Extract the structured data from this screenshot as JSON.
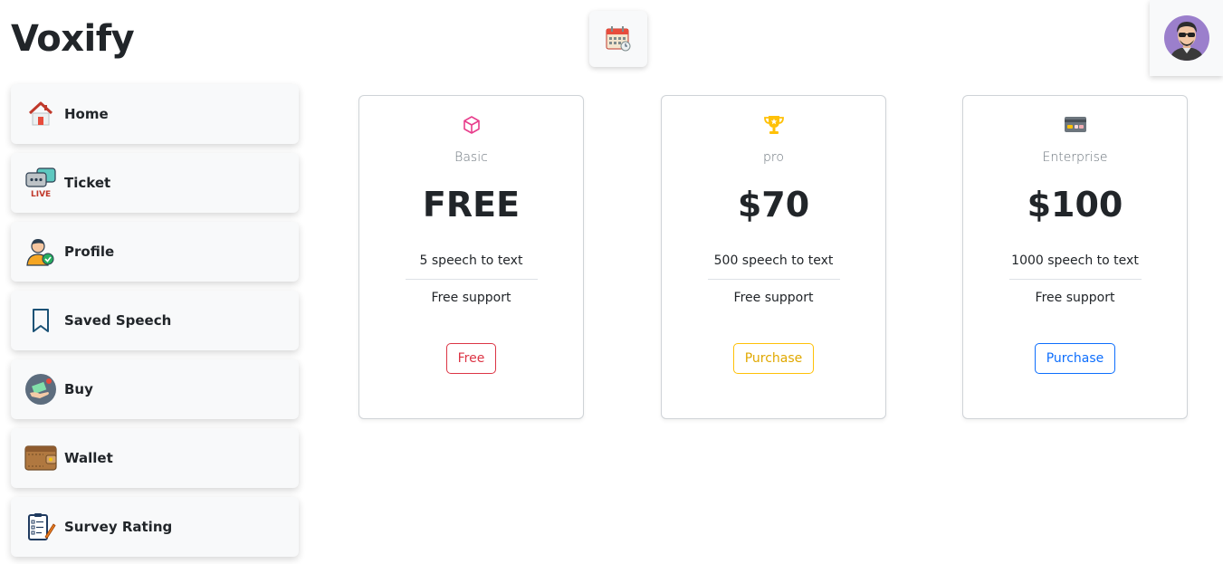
{
  "app": {
    "title": "Voxify"
  },
  "header": {
    "calendar_icon": "calendar-icon",
    "avatar_icon": "avatar-icon"
  },
  "sidebar": {
    "items": [
      {
        "label": "Home",
        "icon": "home-icon"
      },
      {
        "label": "Ticket",
        "icon": "live-chat-icon"
      },
      {
        "label": "Profile",
        "icon": "profile-icon"
      },
      {
        "label": "Saved Speech",
        "icon": "bookmark-icon"
      },
      {
        "label": "Buy",
        "icon": "buy-icon"
      },
      {
        "label": "Wallet",
        "icon": "wallet-icon"
      },
      {
        "label": "Survey Rating",
        "icon": "survey-icon"
      }
    ]
  },
  "plans": [
    {
      "name": "Basic",
      "price": "FREE",
      "feature1": "5 speech to text",
      "feature2": "Free support",
      "button": "Free",
      "icon": "box-icon",
      "accent": "#e83e8c",
      "button_color": "#dc3545"
    },
    {
      "name": "pro",
      "price": "$70",
      "feature1": "500 speech to text",
      "feature2": "Free support",
      "button": "Purchase",
      "icon": "trophy-icon",
      "accent": "#ffc107",
      "button_color": "#ffc107"
    },
    {
      "name": "Enterprise",
      "price": "$100",
      "feature1": "1000 speech to text",
      "feature2": "Free support",
      "button": "Purchase",
      "icon": "credit-card-icon",
      "accent": "#6c757d",
      "button_color": "#0d6efd"
    }
  ]
}
